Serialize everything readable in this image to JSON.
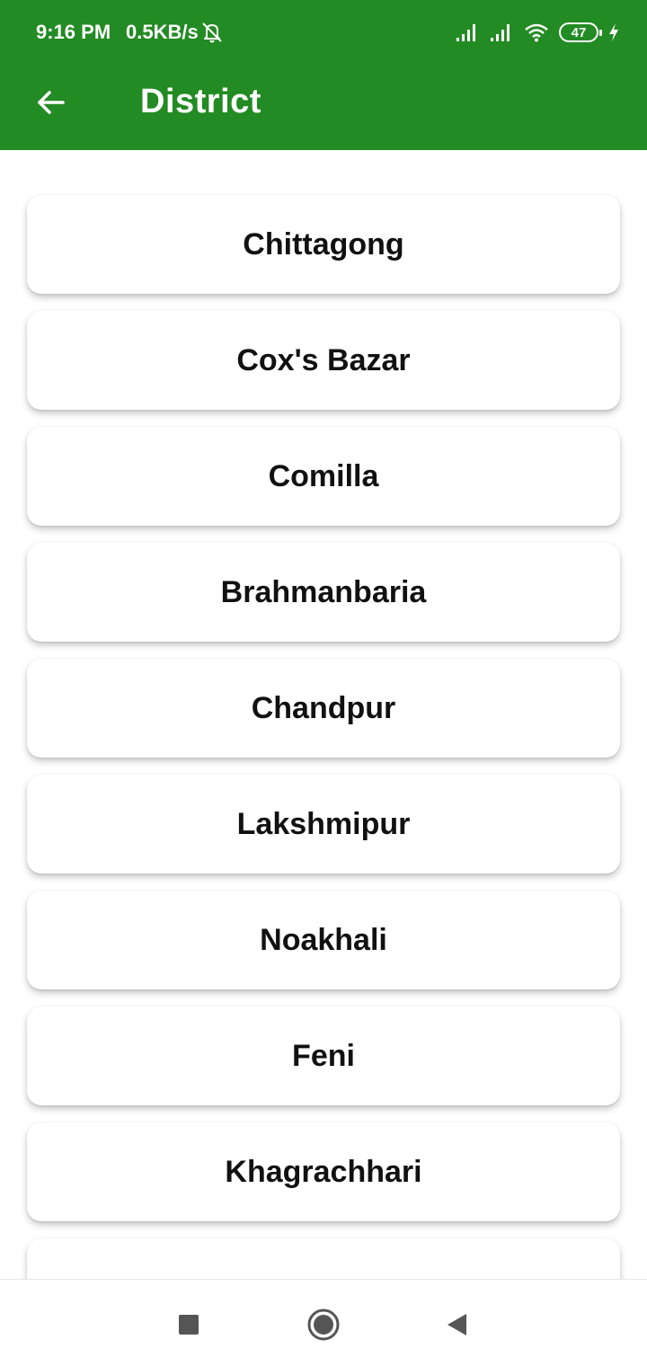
{
  "status_bar": {
    "time": "9:16 PM",
    "net_speed": "0.5KB/s",
    "battery_level": "47",
    "icons": [
      "mute-icon",
      "signal-icon",
      "signal-icon",
      "wifi-icon",
      "battery-icon",
      "charging-icon"
    ]
  },
  "app_bar": {
    "title": "District",
    "back_icon": "back-arrow-icon"
  },
  "districts": [
    {
      "label": "Chittagong"
    },
    {
      "label": "Cox's Bazar"
    },
    {
      "label": "Comilla"
    },
    {
      "label": "Brahmanbaria"
    },
    {
      "label": "Chandpur"
    },
    {
      "label": "Lakshmipur"
    },
    {
      "label": "Noakhali"
    },
    {
      "label": "Feni"
    },
    {
      "label": "Khagrachhari"
    },
    {
      "label": ""
    }
  ],
  "nav_bar": {
    "icons": [
      "recents-icon",
      "home-icon",
      "back-icon"
    ]
  },
  "colors": {
    "app_bar": "#238b23",
    "card_background": "#ffffff",
    "text": "#111111"
  }
}
